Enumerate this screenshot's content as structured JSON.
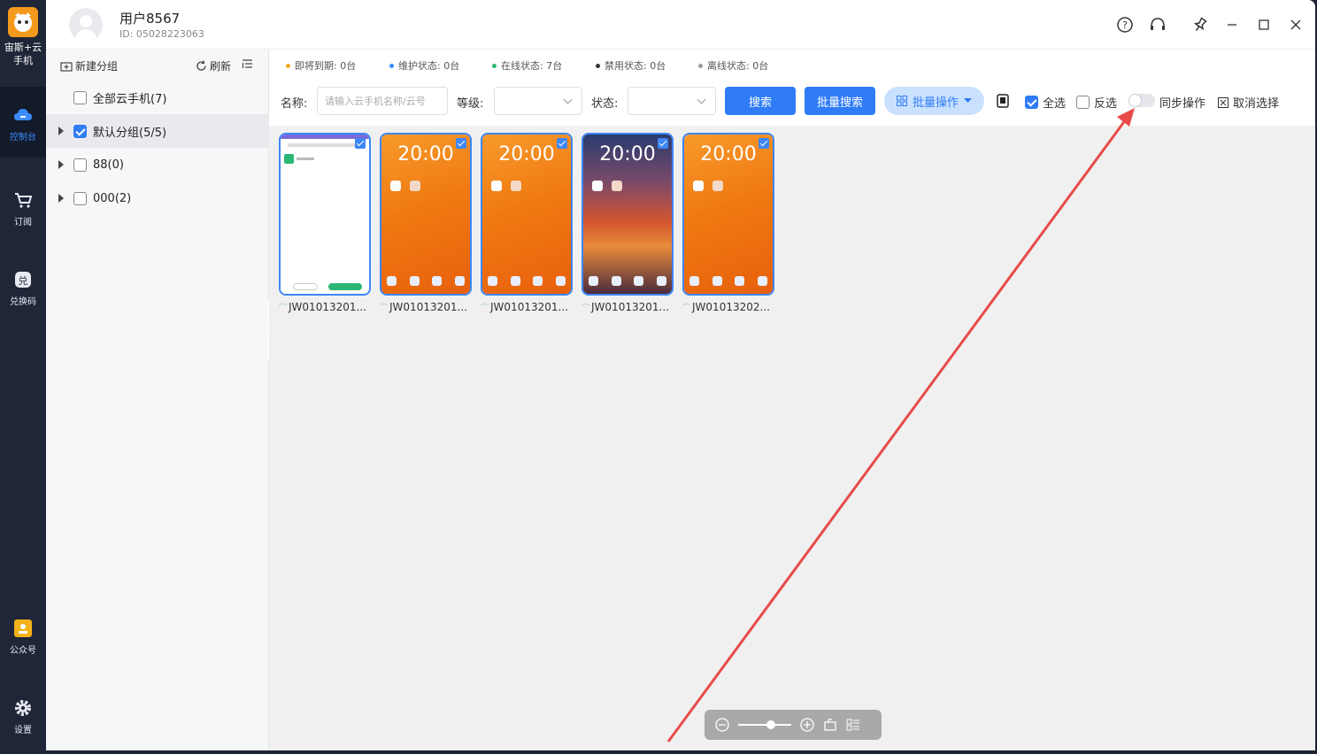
{
  "app": {
    "logo_text": "宙斯+云手机"
  },
  "rail": [
    {
      "label": "控制台",
      "icon": "cloud-icon",
      "active": true
    },
    {
      "label": "订阅",
      "icon": "cart-icon"
    },
    {
      "label": "兑换码",
      "icon": "exchange-icon"
    },
    {
      "label": "公众号",
      "icon": "account-icon"
    },
    {
      "label": "设置",
      "icon": "gear-icon"
    }
  ],
  "user": {
    "name": "用户8567",
    "id": "ID: 05028223063"
  },
  "window_controls": [
    "help-icon",
    "headset-icon",
    "pin-icon",
    "minimize-icon",
    "maximize-icon",
    "close-icon"
  ],
  "groups": {
    "new_group": "新建分组",
    "refresh": "刷新",
    "items": [
      {
        "label": "全部云手机(7)",
        "checked": false,
        "has_caret": false
      },
      {
        "label": "默认分组(5/5)",
        "checked": true,
        "has_caret": true
      },
      {
        "label": "88(0)",
        "checked": false,
        "has_caret": true
      },
      {
        "label": "000(2)",
        "checked": false,
        "has_caret": true
      }
    ]
  },
  "stats": [
    {
      "label": "即将到期: 0台",
      "color": "#f5a623"
    },
    {
      "label": "维护状态: 0台",
      "color": "#3b8cff"
    },
    {
      "label": "在线状态: 7台",
      "color": "#2bb673"
    },
    {
      "label": "禁用状态: 0台",
      "color": "#333333"
    },
    {
      "label": "离线状态: 0台",
      "color": "#999999"
    }
  ],
  "filters": {
    "name_label": "名称:",
    "name_placeholder": "请输入云手机名称/云号",
    "level_label": "等级:",
    "status_label": "状态:",
    "search": "搜索",
    "batch_search": "批量搜索",
    "batch_ops": "批量操作",
    "select_all": "全选",
    "invert": "反选",
    "sync": "同步操作",
    "cancel_select": "取消选择"
  },
  "phones": [
    {
      "name": "JW01013201...",
      "theme": "white",
      "clock": ""
    },
    {
      "name": "JW01013201...",
      "theme": "orange",
      "clock": "20:00"
    },
    {
      "name": "JW01013201...",
      "theme": "orange",
      "clock": "20:00"
    },
    {
      "name": "JW01013201...",
      "theme": "sunset",
      "clock": "20:00"
    },
    {
      "name": "JW01013202...",
      "theme": "orange",
      "clock": "20:00"
    }
  ],
  "colors": {
    "accent": "#2f7cf6",
    "rail": "#1e2638",
    "annotation": "#e84a4a"
  }
}
